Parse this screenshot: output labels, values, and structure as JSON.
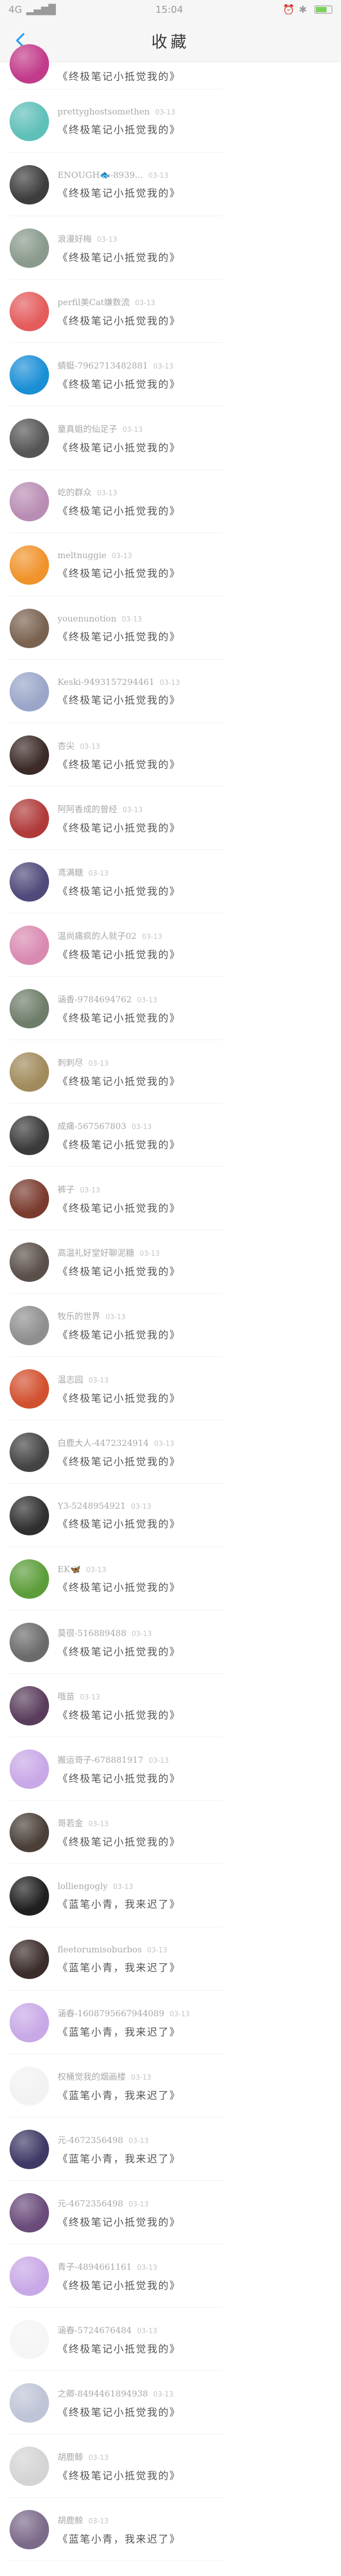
{
  "status": {
    "carrier": "4G",
    "time": "15:04",
    "battery_color": "#7bd15a"
  },
  "nav": {
    "title": "收藏",
    "back_icon": "chevron-left-icon"
  },
  "rows": [
    {
      "name": "",
      "date": "",
      "text": "《终极笔记小抵觉我的》",
      "color": "#c23b8a"
    },
    {
      "name": "prettyghostsomethen",
      "date": "03-13",
      "text": "《终极笔记小抵觉我的》",
      "color": "#5fbfb9"
    },
    {
      "name": "ENOUGH🐟-8939...",
      "date": "03-13",
      "text": "《终极笔记小抵觉我的》",
      "color": "#3d3d3d"
    },
    {
      "name": "浪漫好梅",
      "date": "03-13",
      "text": "《终极笔记小抵觉我的》",
      "color": "#8a9a8c"
    },
    {
      "name": "perfil美Cat嫌数流",
      "date": "03-13",
      "text": "《终极笔记小抵觉我的》",
      "color": "#e45c5c"
    },
    {
      "name": "蜻蜓-7962713482881",
      "date": "03-13",
      "text": "《终极笔记小抵觉我的》",
      "color": "#1a8fd6"
    },
    {
      "name": "童真姐的仙足子",
      "date": "03-13",
      "text": "《终极笔记小抵觉我的》",
      "color": "#555555"
    },
    {
      "name": "屹的群众",
      "date": "03-13",
      "text": "《终极笔记小抵觉我的》",
      "color": "#b98db3"
    },
    {
      "name": "meltnuggie",
      "date": "03-13",
      "text": "《终极笔记小抵觉我的》",
      "color": "#f0932b"
    },
    {
      "name": "youenunotion",
      "date": "03-13",
      "text": "《终极笔记小抵觉我的》",
      "color": "#7a6250"
    },
    {
      "name": "Keski-9493157294461",
      "date": "03-13",
      "text": "《终极笔记小抵觉我的》",
      "color": "#9aa6c9"
    },
    {
      "name": "杏尖",
      "date": "03-13",
      "text": "《终极笔记小抵觉我的》",
      "color": "#3b2a27"
    },
    {
      "name": "阿阿香成的曾经",
      "date": "03-13",
      "text": "《终极笔记小抵觉我的》",
      "color": "#b03a3a"
    },
    {
      "name": "鸢满糖",
      "date": "03-13",
      "text": "《终极笔记小抵觉我的》",
      "color": "#4e4a7a"
    },
    {
      "name": "温尚痛疯的人就子02",
      "date": "03-13",
      "text": "《终极笔记小抵觉我的》",
      "color": "#d98ab1"
    },
    {
      "name": "涵香-9784694762",
      "date": "03-13",
      "text": "《终极笔记小抵觉我的》",
      "color": "#6e7d6a"
    },
    {
      "name": "刺刺尽",
      "date": "03-13",
      "text": "《终极笔记小抵觉我的》",
      "color": "#a18a5c"
    },
    {
      "name": "成痛-567567803",
      "date": "03-13",
      "text": "《终极笔记小抵觉我的》",
      "color": "#3a3a3a"
    },
    {
      "name": "裤子",
      "date": "03-13",
      "text": "《终极笔记小抵觉我的》",
      "color": "#7a3b2e"
    },
    {
      "name": "高温礼好堂好聊泥糖",
      "date": "03-13",
      "text": "《终极笔记小抵觉我的》",
      "color": "#5a4f49"
    },
    {
      "name": "牧乐的世界",
      "date": "03-13",
      "text": "《终极笔记小抵觉我的》",
      "color": "#8f8f8f"
    },
    {
      "name": "温志园",
      "date": "03-13",
      "text": "《终极笔记小抵觉我的》",
      "color": "#d2502f"
    },
    {
      "name": "白鹿大人-4472324914",
      "date": "03-13",
      "text": "《终极笔记小抵觉我的》",
      "color": "#444444"
    },
    {
      "name": "Y3-5248954921",
      "date": "03-13",
      "text": "《终极笔记小抵觉我的》",
      "color": "#2f2f2f"
    },
    {
      "name": "EK🦋",
      "date": "03-13",
      "text": "《终极笔记小抵觉我的》",
      "color": "#5c9d3a"
    },
    {
      "name": "莫很-516889488",
      "date": "03-13",
      "text": "《终极笔记小抵觉我的》",
      "color": "#6b6b6b"
    },
    {
      "name": "哦苗",
      "date": "03-13",
      "text": "《终极笔记小抵觉我的》",
      "color": "#5a3d5c"
    },
    {
      "name": "搬运哥子-678881917",
      "date": "03-13",
      "text": "《终极笔记小抵觉我的》",
      "color": "#c8a8e6"
    },
    {
      "name": "哥若金",
      "date": "03-13",
      "text": "《终极笔记小抵觉我的》",
      "color": "#4a4038"
    },
    {
      "name": "lolliengogly",
      "date": "03-13",
      "text": "《蓝笔小青，我来迟了》",
      "color": "#1f1f1f"
    },
    {
      "name": "fleetorumisoburbos",
      "date": "03-13",
      "text": "《蓝笔小青，我来迟了》",
      "color": "#3a2c2a"
    },
    {
      "name": "涵春-1608795667944089",
      "date": "03-13",
      "text": "《蓝笔小青，我来迟了》",
      "color": "#c8a8e6"
    },
    {
      "name": "权桶觉我的烟画楼",
      "date": "03-13",
      "text": "《蓝笔小青，我来迟了》",
      "color": "#f2f2f2"
    },
    {
      "name": "元-4672356498",
      "date": "03-13",
      "text": "《蓝笔小青，我来迟了》",
      "color": "#3d3a66"
    },
    {
      "name": "元-4672356498",
      "date": "03-13",
      "text": "《终极笔记小抵觉我的》",
      "color": "#6a4b7a"
    },
    {
      "name": "青子-4894661161",
      "date": "03-13",
      "text": "《终极笔记小抵觉我的》",
      "color": "#c8a8e6"
    },
    {
      "name": "涵春-5724676484",
      "date": "03-13",
      "text": "《终极笔记小抵觉我的》",
      "color": "#f5f5f5"
    },
    {
      "name": "之卿-8494461894938",
      "date": "03-13",
      "text": "《终极笔记小抵觉我的》",
      "color": "#bfc4d6"
    },
    {
      "name": "胡鹿鲸",
      "date": "03-13",
      "text": "《终极笔记小抵觉我的》",
      "color": "#d4d4d4"
    },
    {
      "name": "胡鹿鲸",
      "date": "03-13",
      "text": "《蓝笔小青，我来迟了》",
      "color": "#7c6a8a"
    }
  ]
}
